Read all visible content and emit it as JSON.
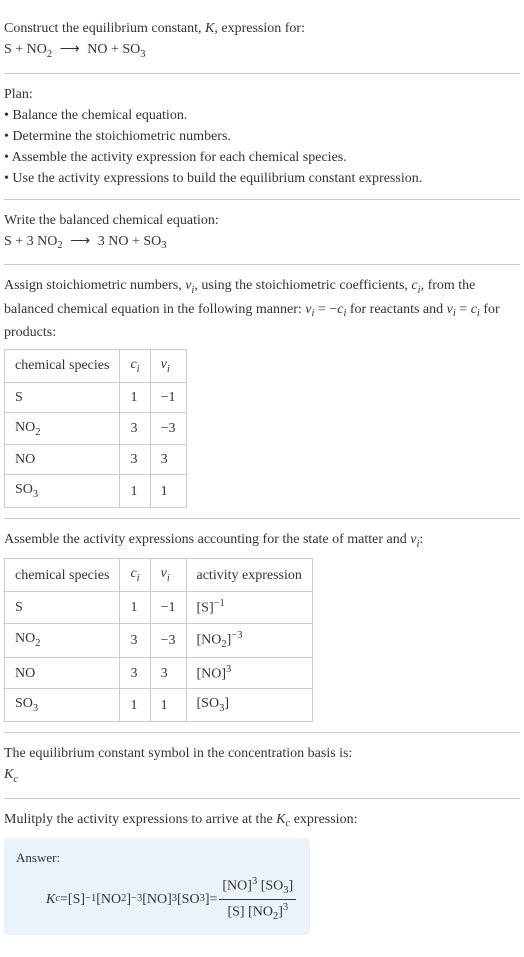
{
  "header": {
    "line1": "Construct the equilibrium constant, ",
    "Kvar": "K",
    "line1b": ", expression for:",
    "equation_lhs_1": "S + NO",
    "equation_lhs_sub": "2",
    "equation_rhs_1": " NO + SO",
    "equation_rhs_sub": "3"
  },
  "plan": {
    "title": "Plan:",
    "b1": "• Balance the chemical equation.",
    "b2": "• Determine the stoichiometric numbers.",
    "b3": "• Assemble the activity expression for each chemical species.",
    "b4": "• Use the activity expressions to build the equilibrium constant expression."
  },
  "balanced": {
    "title": "Write the balanced chemical equation:",
    "lhs1": "S + 3 NO",
    "lhs_sub": "2",
    "rhs1": " 3 NO + SO",
    "rhs_sub": "3"
  },
  "assign": {
    "text1": "Assign stoichiometric numbers, ",
    "nu": "ν",
    "isub": "i",
    "text2": ", using the stoichiometric coefficients, ",
    "c": "c",
    "text3": ", from the balanced chemical equation in the following manner: ",
    "eq1_l": "ν",
    "eq1_eq": " = −",
    "text4": " for reactants and ",
    "eq2_eq": " = ",
    "text5": " for products:",
    "hdr_species": "chemical species",
    "hdr_c": "c",
    "hdr_nu": "ν",
    "r1": {
      "species": "S",
      "c": "1",
      "nu": "−1"
    },
    "r2": {
      "species": "NO",
      "sub": "2",
      "c": "3",
      "nu": "−3"
    },
    "r3": {
      "species": "NO",
      "c": "3",
      "nu": "3"
    },
    "r4": {
      "species": "SO",
      "sub": "3",
      "c": "1",
      "nu": "1"
    }
  },
  "activity": {
    "text1": "Assemble the activity expressions accounting for the state of matter and ",
    "text2": ":",
    "hdr_species": "chemical species",
    "hdr_activity": "activity expression",
    "r1": {
      "species": "S",
      "c": "1",
      "nu": "−1",
      "act": "[S]",
      "exp": "−1"
    },
    "r2": {
      "species": "NO",
      "sub": "2",
      "c": "3",
      "nu": "−3",
      "act_open": "[NO",
      "act_sub": "2",
      "act_close": "]",
      "exp": "−3"
    },
    "r3": {
      "species": "NO",
      "c": "3",
      "nu": "3",
      "act": "[NO]",
      "exp": "3"
    },
    "r4": {
      "species": "SO",
      "sub": "3",
      "c": "1",
      "nu": "1",
      "act_open": "[SO",
      "act_sub": "3",
      "act_close": "]"
    }
  },
  "symbol": {
    "text": "The equilibrium constant symbol in the concentration basis is:",
    "K": "K",
    "csub": "c"
  },
  "multiply": {
    "text1": "Mulitply the activity expressions to arrive at the ",
    "K": "K",
    "csub": "c",
    "text2": " expression:"
  },
  "answer": {
    "label": "Answer:",
    "Kc_K": "K",
    "Kc_c": "c",
    "eq": " = ",
    "t1": "[S]",
    "e1": "−1",
    "t2o": " [NO",
    "t2s": "2",
    "t2c": "]",
    "e2": "−3",
    "t3": " [NO]",
    "e3": "3",
    "t4o": " [SO",
    "t4s": "3",
    "t4c": "]",
    "eq2": " = ",
    "num1": "[NO]",
    "nume1": "3",
    "num2o": " [SO",
    "num2s": "3",
    "num2c": "]",
    "den1": "[S]",
    "den2o": " [NO",
    "den2s": "2",
    "den2c": "]",
    "dene2": "3"
  },
  "arrow": "⟶"
}
